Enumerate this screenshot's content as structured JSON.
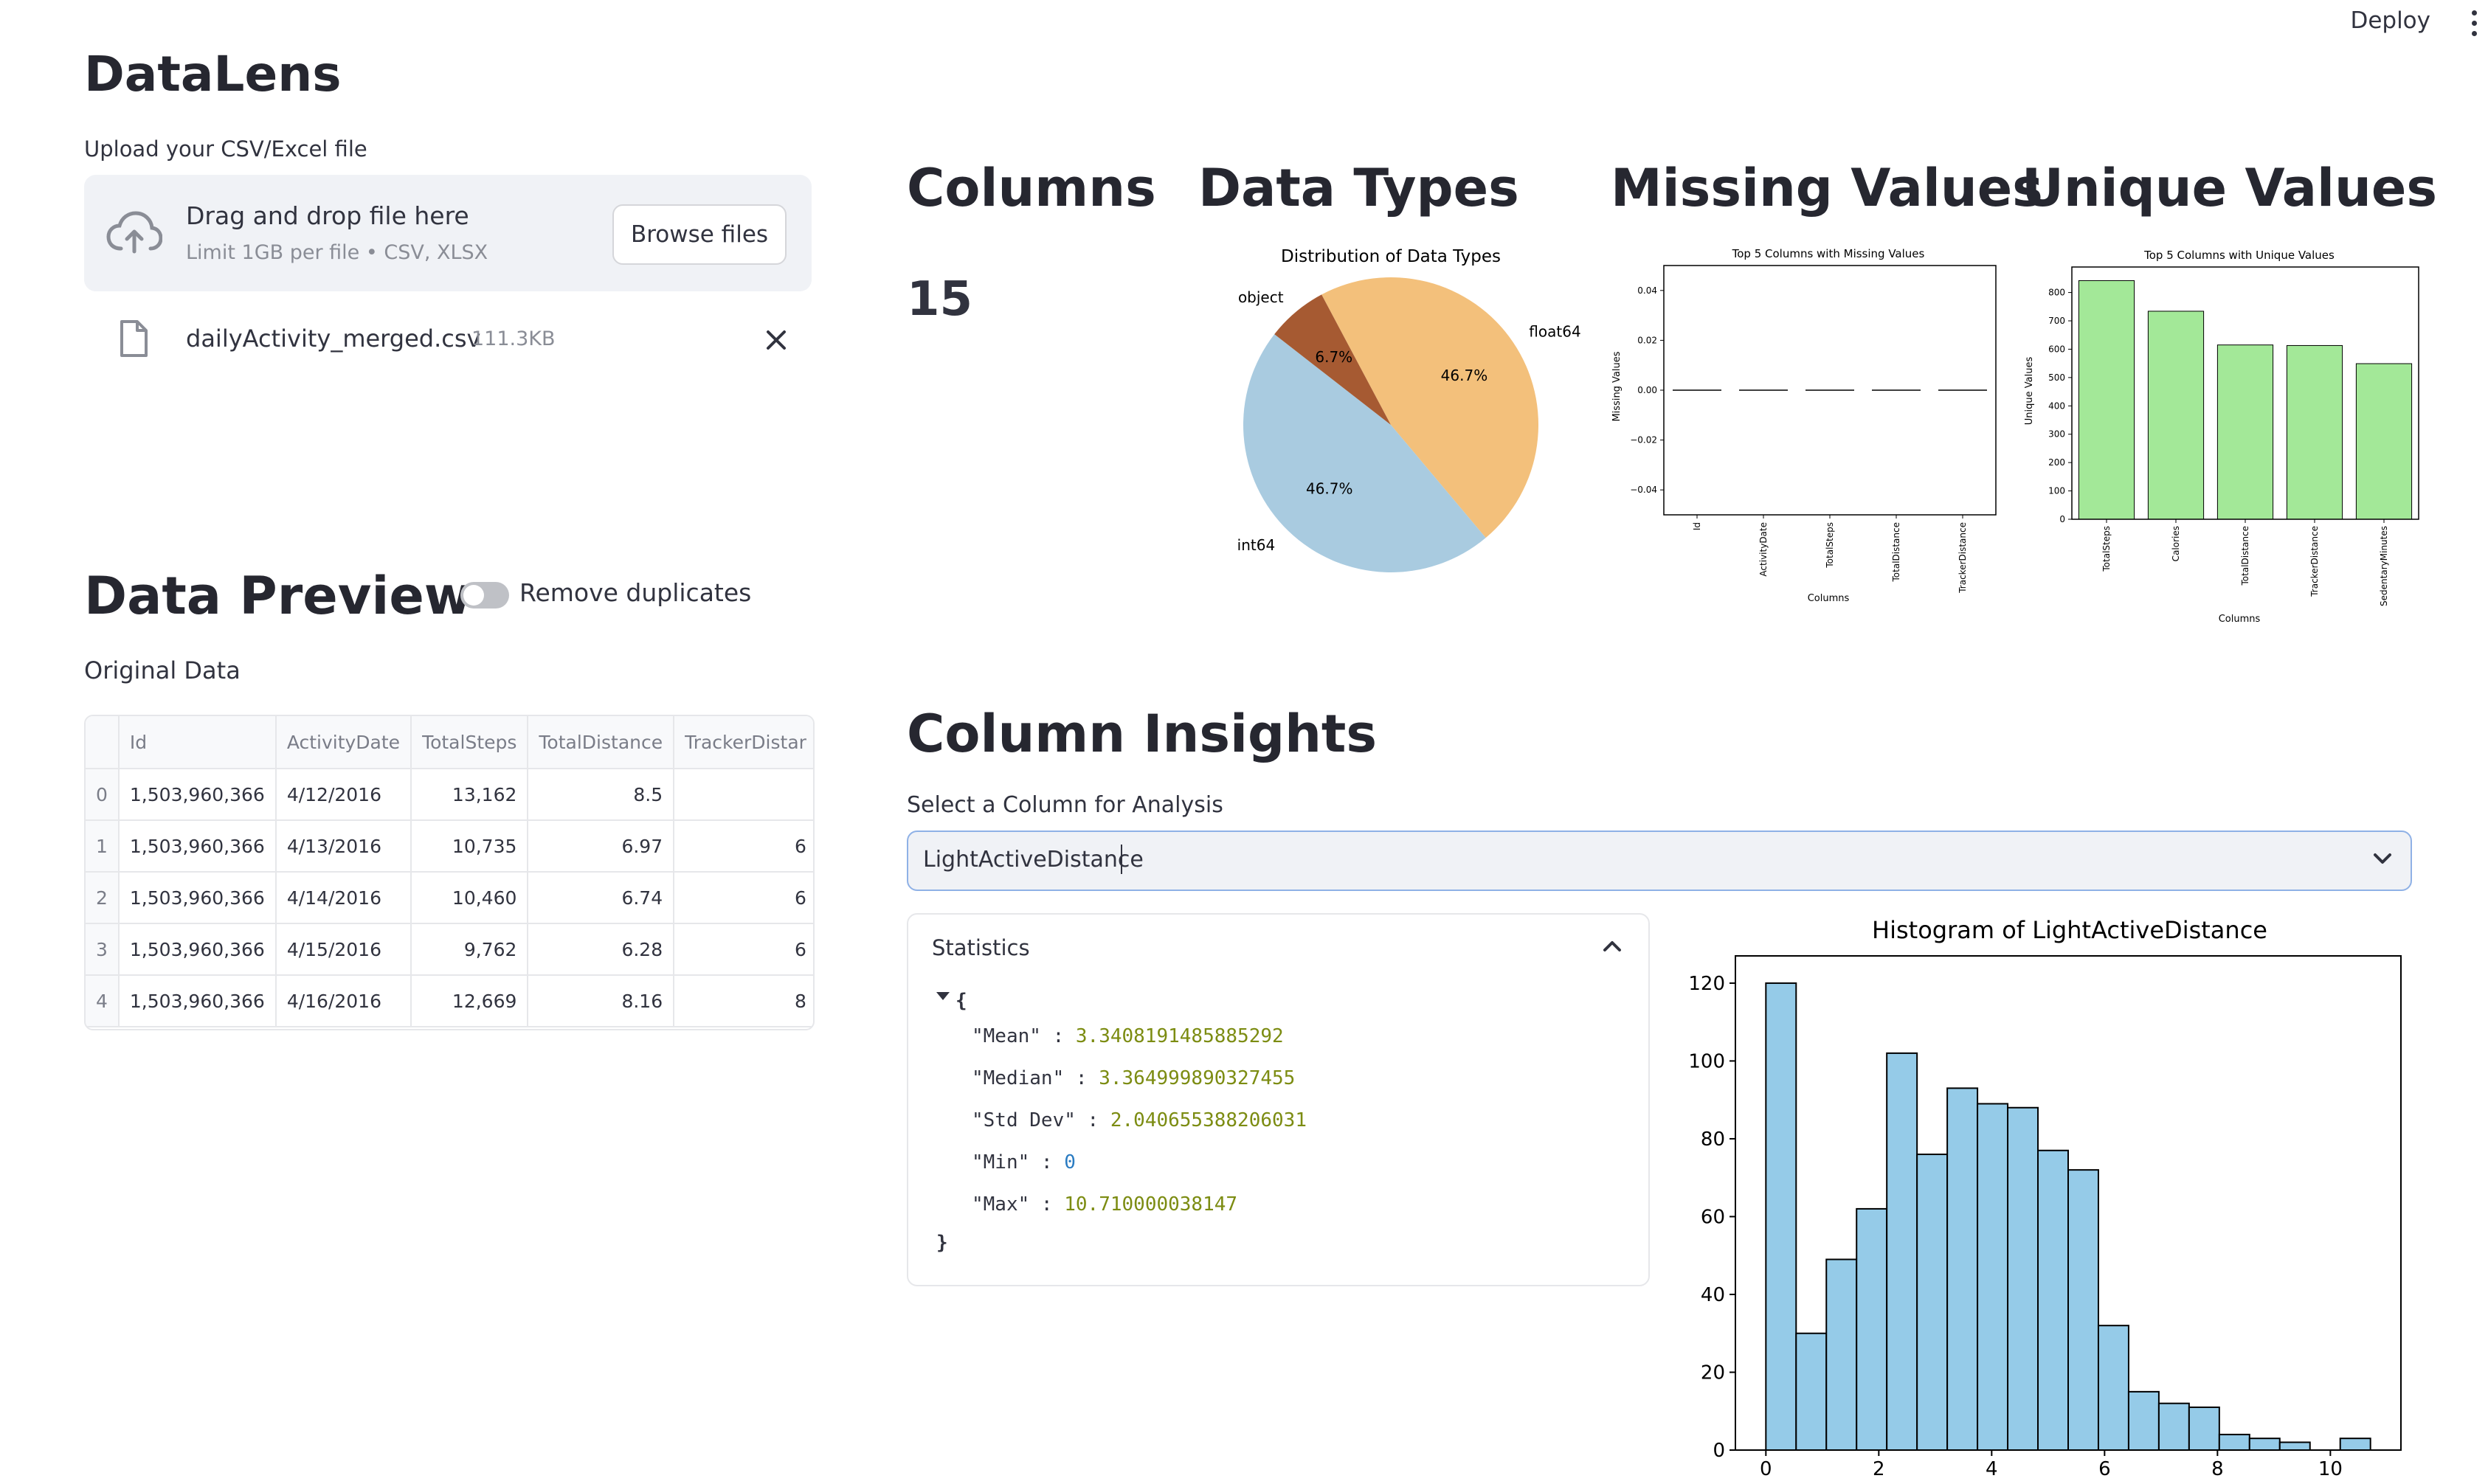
{
  "toolbar": {
    "deploy_label": "Deploy"
  },
  "app": {
    "title": "DataLens"
  },
  "upload": {
    "label": "Upload your CSV/Excel file",
    "drop_text": "Drag and drop file here",
    "limit_text": "Limit 1GB per file • CSV, XLSX",
    "browse_label": "Browse files",
    "file_name": "dailyActivity_merged.csv",
    "file_size": "111.3KB"
  },
  "metrics": {
    "columns_title": "Columns",
    "columns_value": "15",
    "data_types_title": "Data Types",
    "missing_title": "Missing Values",
    "unique_title": "Unique Values"
  },
  "preview": {
    "title": "Data Preview",
    "toggle_label": "Remove duplicates",
    "subtitle": "Original Data",
    "columns": [
      "",
      "Id",
      "ActivityDate",
      "TotalSteps",
      "TotalDistance",
      "TrackerDistar"
    ],
    "rows": [
      [
        "0",
        "1,503,960,366",
        "4/12/2016",
        "13,162",
        "8.5",
        ""
      ],
      [
        "1",
        "1,503,960,366",
        "4/13/2016",
        "10,735",
        "6.97",
        "6"
      ],
      [
        "2",
        "1,503,960,366",
        "4/14/2016",
        "10,460",
        "6.74",
        "6"
      ],
      [
        "3",
        "1,503,960,366",
        "4/15/2016",
        "9,762",
        "6.28",
        "6"
      ],
      [
        "4",
        "1,503,960,366",
        "4/16/2016",
        "12,669",
        "8.16",
        "8"
      ]
    ]
  },
  "insights": {
    "title": "Column Insights",
    "select_label": "Select a Column for Analysis",
    "selected": "LightActiveDistance",
    "stats_title": "Statistics",
    "stats": {
      "open": "{",
      "close": "}",
      "items": [
        {
          "key": "\"Mean\"",
          "value": "3.3408191485885292"
        },
        {
          "key": "\"Median\"",
          "value": "3.364999890327455"
        },
        {
          "key": "\"Std Dev\"",
          "value": "2.040655388206031"
        },
        {
          "key": "\"Min\"",
          "value": "0"
        },
        {
          "key": "\"Max\"",
          "value": "10.710000038147"
        }
      ]
    }
  },
  "chart_data": [
    {
      "type": "pie",
      "title": "Distribution of Data Types",
      "labels": [
        "float64",
        "int64",
        "object"
      ],
      "values": [
        46.7,
        46.7,
        6.7
      ],
      "value_labels": [
        "46.7%",
        "46.7%",
        "6.7%"
      ],
      "colors": [
        "#f3c07b",
        "#a9cbe0",
        "#a65a32"
      ]
    },
    {
      "type": "line",
      "title": "Top 5 Columns with Missing Values",
      "xlabel": "Columns",
      "ylabel": "Missing Values",
      "categories": [
        "Id",
        "ActivityDate",
        "TotalSteps",
        "TotalDistance",
        "TrackerDistance"
      ],
      "values": [
        0,
        0,
        0,
        0,
        0
      ],
      "ylim": [
        -0.05,
        0.05
      ],
      "yticks": [
        "0.04",
        "0.02",
        "0.00",
        "−0.02",
        "−0.04"
      ]
    },
    {
      "type": "bar",
      "title": "Top 5 Columns with Unique Values",
      "xlabel": "Columns",
      "ylabel": "Unique Values",
      "categories": [
        "TotalSteps",
        "Calories",
        "TotalDistance",
        "TrackerDistance",
        "SedentaryMinutes"
      ],
      "values": [
        842,
        734,
        615,
        613,
        549
      ],
      "ylim": [
        0,
        890
      ],
      "yticks": [
        "0",
        "100",
        "200",
        "300",
        "400",
        "500",
        "600",
        "700",
        "800"
      ],
      "color": "#a3e898"
    },
    {
      "type": "bar",
      "title": "Histogram of LightActiveDistance",
      "bins_start": 0,
      "bin_width": 0.5355,
      "values": [
        120,
        30,
        49,
        62,
        102,
        76,
        93,
        89,
        88,
        77,
        72,
        32,
        15,
        12,
        11,
        4,
        3,
        2,
        0,
        3
      ],
      "ylim": [
        0,
        127
      ],
      "xlim": [
        -0.54,
        11.25
      ],
      "xticks": [
        "0",
        "2",
        "4",
        "6",
        "8",
        "10"
      ],
      "yticks": [
        "0",
        "20",
        "40",
        "60",
        "80",
        "100",
        "120"
      ],
      "color": "#95cbe8"
    }
  ]
}
